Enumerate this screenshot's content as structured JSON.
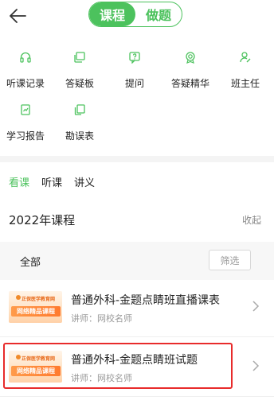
{
  "header": {
    "back_icon": "arrow-left-icon",
    "segments": [
      {
        "label": "课程",
        "active": true
      },
      {
        "label": "做题",
        "active": false
      }
    ]
  },
  "grid": [
    {
      "label": "听课记录",
      "icon": "headphones-icon"
    },
    {
      "label": "答疑板",
      "icon": "stacked-cards-icon"
    },
    {
      "label": "提问",
      "icon": "question-box-icon"
    },
    {
      "label": "答疑精华",
      "icon": "badge-icon"
    },
    {
      "label": "班主任",
      "icon": "user-edit-icon"
    },
    {
      "label": "学习报告",
      "icon": "report-icon"
    },
    {
      "label": "勘误表",
      "icon": "copy-icon"
    }
  ],
  "tabs": [
    {
      "label": "看课",
      "active": true
    },
    {
      "label": "听课",
      "active": false
    },
    {
      "label": "讲义",
      "active": false
    }
  ],
  "section": {
    "title": "2022年课程",
    "collapse_label": "收起"
  },
  "filter": {
    "all_label": "全部",
    "filter_button": "筛选"
  },
  "courses": [
    {
      "title": "普通外科-金题点睛班直播课表",
      "teacher": "讲师：网校名师",
      "thumb_text": "网络精品课程",
      "thumb_logo": "正保医学教育网"
    },
    {
      "title": "普通外科-金题点睛班试题",
      "teacher": "讲师：网校名师",
      "thumb_text": "网络精品课程",
      "thumb_logo": "正保医学教育网"
    }
  ],
  "colors": {
    "accent": "#4cc25d",
    "highlight": "#e82b2b"
  }
}
